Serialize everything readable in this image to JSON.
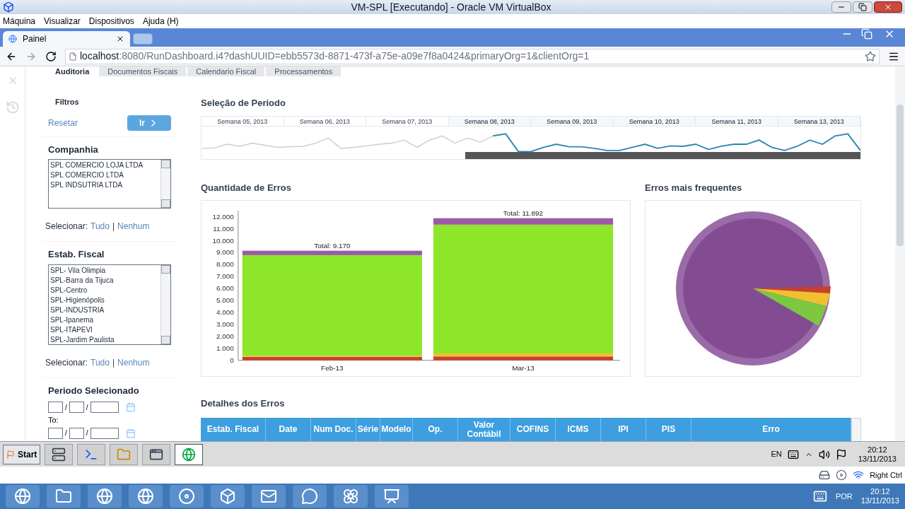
{
  "vm_window": {
    "title": "VM-SPL [Executando] - Oracle VM VirtualBox",
    "menu": [
      "Máquina",
      "Visualizar",
      "Dispositivos",
      "Ajuda (H)"
    ]
  },
  "browser": {
    "tabs": [
      {
        "label": "Painel",
        "selected": true
      }
    ],
    "url_host": "localhost",
    "url_rest": ":8080/RunDashboard.i4?dashUUID=ebb5573d-8871-473f-a75e-a09e7f8a0424&primaryOrg=1&clientOrg=1"
  },
  "page_tabs": [
    {
      "label": "Auditoria",
      "selected": true
    },
    {
      "label": "Documentos Fiscais",
      "selected": false
    },
    {
      "label": "Calendario Fiscal",
      "selected": false
    },
    {
      "label": "Processamentos",
      "selected": false
    }
  ],
  "filters": {
    "title": "Filtros",
    "reset": "Resetar",
    "go": "Ir",
    "groups": [
      {
        "kind": "list",
        "title": "Companhia",
        "items": [
          "SPL COMERCIO LOJA LTDA",
          "SPL COMERCIO LTDA",
          "SPL INDSUTRIA LTDA"
        ],
        "select_label": "Selecionar:",
        "all": "Tudo",
        "separator": "|",
        "none": "Nenhum"
      },
      {
        "kind": "list",
        "title": "Estab. Fiscal",
        "items": [
          "SPL- Vila Olimpia",
          "SPL-Barra da Tijuca",
          "SPL-Centro",
          "SPL-Higienópolis",
          "SPL-INDUSTRIA",
          "SPL-Ipanema",
          "SPL-ITAPEVI",
          "SPL-Jardim Paulista"
        ],
        "select_label": "Selecionar:",
        "all": "Tudo",
        "separator": "|",
        "none": "Nenhum"
      },
      {
        "kind": "dates",
        "title": "Periodo Selecionado",
        "sep": "/",
        "to": "To:"
      }
    ]
  },
  "period": {
    "title": "Seleção de Periodo",
    "weeks": [
      {
        "label": "Semana 05, 2013",
        "selected": false
      },
      {
        "label": "Semana 06, 2013",
        "selected": false
      },
      {
        "label": "Semana 07, 2013",
        "selected": false
      },
      {
        "label": "Semana 08, 2013",
        "selected": true
      },
      {
        "label": "Semana 09, 2013",
        "selected": true
      },
      {
        "label": "Semana 10, 2013",
        "selected": true
      },
      {
        "label": "Semana 11, 2013",
        "selected": true
      },
      {
        "label": "Semana 13, 2013",
        "selected": true
      }
    ]
  },
  "errors_chart": {
    "title": "Quantidade de Erros",
    "totals": [
      "Total: 9.170",
      "Total: 11.892"
    ],
    "chart_data": {
      "type": "bar",
      "stacked": true,
      "categories": [
        "Feb-13",
        "Mar-13"
      ],
      "ylim": [
        0,
        12500
      ],
      "yticks": [
        {
          "value": 0,
          "label": "0"
        },
        {
          "value": 1000,
          "label": "1.000"
        },
        {
          "value": 2000,
          "label": "2.000"
        },
        {
          "value": 3000,
          "label": "3.000"
        },
        {
          "value": 4000,
          "label": "4.000"
        },
        {
          "value": 5000,
          "label": "5.000"
        },
        {
          "value": 6000,
          "label": "6.000"
        },
        {
          "value": 7000,
          "label": "7.000"
        },
        {
          "value": 8000,
          "label": "8.000"
        },
        {
          "value": 9000,
          "label": "9.000"
        },
        {
          "value": 10000,
          "label": "10.000"
        },
        {
          "value": 11000,
          "label": "11.000"
        },
        {
          "value": 12000,
          "label": "12.000"
        }
      ],
      "series": [
        {
          "color": "#c8402c",
          "values": [
            300,
            320
          ]
        },
        {
          "color": "#f0c030",
          "values": [
            80,
            250
          ]
        },
        {
          "color": "#8ee62a",
          "values": [
            8420,
            10780
          ]
        },
        {
          "color": "#9a5aa6",
          "values": [
            370,
            540
          ]
        }
      ]
    }
  },
  "frequent_errors": {
    "title": "Erros mais frequentes"
  },
  "details": {
    "title": "Detalhes dos Erros",
    "columns": [
      "Estab. Fiscal",
      "Date",
      "Num Doc.",
      "Série",
      "Modelo",
      "Op.",
      "Valor Contábil",
      "COFINS",
      "ICMS",
      "IPI",
      "PIS",
      "Erro"
    ]
  },
  "guest_taskbar": {
    "start": "Start",
    "apps": [
      {
        "kind": "server",
        "selected": false
      },
      {
        "kind": "shell",
        "selected": false
      },
      {
        "kind": "folder",
        "selected": false
      },
      {
        "kind": "window",
        "selected": false
      },
      {
        "kind": "browser",
        "selected": true
      }
    ],
    "lang": "EN",
    "time": "20:12",
    "date": "13/11/2013"
  },
  "vbox_status": {
    "host_key": "Right Ctrl"
  },
  "host_taskbar": {
    "apps": [
      {
        "kind": "browser"
      },
      {
        "kind": "folder"
      },
      {
        "kind": "browser"
      },
      {
        "kind": "browser"
      },
      {
        "kind": "record"
      },
      {
        "kind": "box"
      },
      {
        "kind": "mail"
      },
      {
        "kind": "chat"
      },
      {
        "kind": "flower"
      },
      {
        "kind": "slides"
      }
    ],
    "lang": "POR",
    "time": "20:12",
    "date": "13/11/2013"
  }
}
